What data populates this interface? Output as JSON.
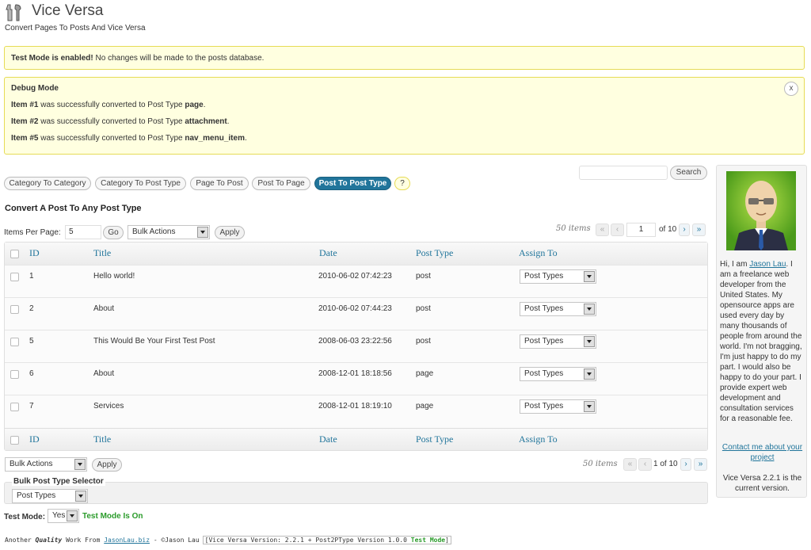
{
  "header": {
    "title": "Vice Versa",
    "subtitle": "Convert Pages To Posts And Vice Versa"
  },
  "notice_test": {
    "bold": "Test Mode is enabled!",
    "text": " No changes will be made to the posts database."
  },
  "debug": {
    "title": "Debug Mode",
    "close": "x",
    "lines": [
      {
        "item": "Item #1",
        "text": " was successfully converted to Post Type ",
        "type": "page",
        "end": "."
      },
      {
        "item": "Item #2",
        "text": " was successfully converted to Post Type ",
        "type": "attachment",
        "end": "."
      },
      {
        "item": "Item #5",
        "text": " was successfully converted to Post Type ",
        "type": "nav_menu_item",
        "end": "."
      }
    ]
  },
  "tabs": [
    "Category To Category",
    "Category To Post Type",
    "Page To Post",
    "Post To Page",
    "Post To Post Type",
    "?"
  ],
  "active_tab": "Post To Post Type",
  "search": {
    "button": "Search",
    "value": ""
  },
  "section_title": "Convert A Post To Any Post Type",
  "controls": {
    "ipp_label": "Items Per Page:",
    "ipp_value": "5",
    "go": "Go",
    "bulk_actions": "Bulk Actions",
    "apply": "Apply",
    "items_count": "50 items",
    "page": "1",
    "of_pages": "of 10",
    "bottom_of": "1 of 10",
    "first": "«",
    "prev": "‹",
    "next": "›",
    "last": "»"
  },
  "table": {
    "headers": [
      "ID",
      "Title",
      "Date",
      "Post Type",
      "Assign To"
    ],
    "rows": [
      {
        "id": "1",
        "title": "Hello world!",
        "date": "2010-06-02 07:42:23",
        "type": "post",
        "assign": "Post Types"
      },
      {
        "id": "2",
        "title": "About",
        "date": "2010-06-02 07:44:23",
        "type": "post",
        "assign": "Post Types"
      },
      {
        "id": "5",
        "title": "This Would Be Your First Test Post",
        "date": "2008-06-03 23:22:56",
        "type": "post",
        "assign": "Post Types"
      },
      {
        "id": "6",
        "title": "About",
        "date": "2008-12-01 18:18:56",
        "type": "page",
        "assign": "Post Types"
      },
      {
        "id": "7",
        "title": "Services",
        "date": "2008-12-01 18:19:10",
        "type": "page",
        "assign": "Post Types"
      }
    ]
  },
  "bulk_selector": {
    "legend": "Bulk Post Type Selector",
    "value": "Post Types"
  },
  "test_mode": {
    "label": "Test Mode:",
    "value": "Yes",
    "status": "Test Mode Is On"
  },
  "sidebar": {
    "bio_pre": "Hi, I am ",
    "name_link": "Jason Lau",
    "bio_post": ". I am a freelance web developer from the United States. My opensource apps are used every day by many thousands of people from around the world. I'm not bragging, I'm just happy to do my part. I would also be happy to do your part. I provide expert web development and consultation services for a reasonable fee.",
    "contact": "Contact me about your project",
    "version_note": "Vice Versa 2.2.1 is the current version."
  },
  "footer": {
    "pre": "Another ",
    "quality": "Quality",
    "mid": " Work From ",
    "link": "JasonLau.biz",
    "author": " - ©Jason Lau",
    "version": "[Vice Versa Version: 2.2.1 + Post2PType Version 1.0.0 ",
    "test": "Test Mode",
    "close": "]"
  },
  "colors": {
    "accent": "#21759b",
    "notice_bg": "#ffffe0",
    "notice_border": "#e6db55",
    "green": "#2a9b2a"
  }
}
